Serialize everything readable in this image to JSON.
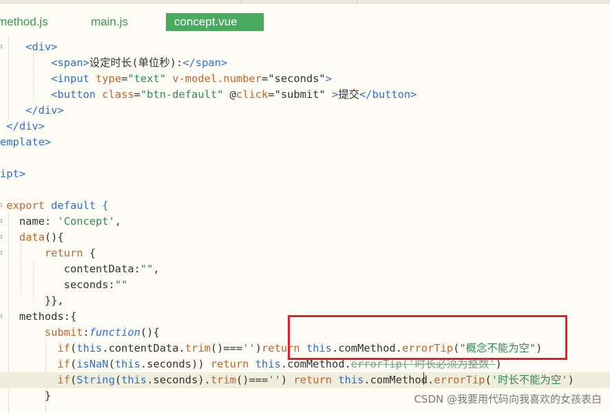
{
  "tabs": [
    {
      "label": "method.js",
      "active": false
    },
    {
      "label": "main.js",
      "active": false
    },
    {
      "label": "concept.vue",
      "active": true
    }
  ],
  "code": {
    "l1": {
      "a": "<div>"
    },
    "l2": {
      "a": "<span>",
      "b": "设定时长(单位秒):",
      "c": "</span>"
    },
    "l3": {
      "a": "<input ",
      "b": "type",
      "c": "=",
      "d": "\"text\"",
      "e": " ",
      "f": "v-model.number",
      "g": "=",
      "h": "\"seconds\"",
      "i": ">"
    },
    "l4": {
      "a": "<button ",
      "b": "class",
      "c": "=",
      "d": "\"btn-default\"",
      "e": " @",
      "f": "click",
      "g": "=",
      "h": "\"submit\"",
      "i": " >",
      "j": "提交",
      "k": "</button>"
    },
    "l5": {
      "a": "</div>"
    },
    "l6": {
      "a": "</div>"
    },
    "l7": {
      "a": "emplate>"
    },
    "l8": {
      "a": "ipt>"
    },
    "l9": {
      "a": "export",
      "b": " default {"
    },
    "l10": {
      "a": "name: ",
      "b": "'Concept'",
      "c": ","
    },
    "l11": {
      "a": "data",
      "b": "(){"
    },
    "l12": {
      "a": "return",
      "b": " {"
    },
    "l13": {
      "a": "contentData:",
      "b": "\"\"",
      "c": ","
    },
    "l14": {
      "a": "seconds:",
      "b": "\"\""
    },
    "l15": {
      "a": "}},"
    },
    "l16": {
      "a": "methods:{"
    },
    "l17": {
      "a": "submit",
      "b": ":",
      "c": "function",
      "d": "(){"
    },
    "l18": {
      "a": "if",
      "b": "(",
      "c": "this",
      "d": ".contentData.",
      "e": "trim",
      "f": "()===",
      "g": "''",
      "h": ")",
      "i": "return",
      "j": " ",
      "k": "this",
      "l": ".comMethod.",
      "m": "errorTip",
      "n": "(",
      "o": "\"概念不能为空\"",
      "p": ")"
    },
    "l19": {
      "a": "if",
      "b": "(",
      "c": "isNaN",
      "d": "(",
      "e": "this",
      "f": ".seconds)) ",
      "g": "return",
      "h": " ",
      "i": "this",
      "j": ".comMethod.",
      "k": "errorTip",
      "l": "(",
      "m": "'时长必须为整数'",
      "n": ")"
    },
    "l20": {
      "a": "if",
      "b": "(",
      "c": "String",
      "d": "(",
      "e": "this",
      "f": ".seconds).",
      "g": "trim",
      "h": "()===",
      "i": "''",
      "j": ") ",
      "k": "return",
      "l": " ",
      "m": "this",
      "n": ".comMethod.",
      "o": "errorTip",
      "p": "(",
      "q": "'时长不能为空'",
      "r": ")"
    },
    "l21": {
      "a": "}"
    }
  },
  "watermark": "CSDN @我要用代码向我喜欢的女孩表白",
  "colors": {
    "tab_active_bg": "#49ab5e",
    "tab_text": "#3a9a4e",
    "highlight_border": "#e0202b",
    "tag": "#2f6fd0",
    "attribute": "#c4632b",
    "string": "#2e8b57"
  }
}
